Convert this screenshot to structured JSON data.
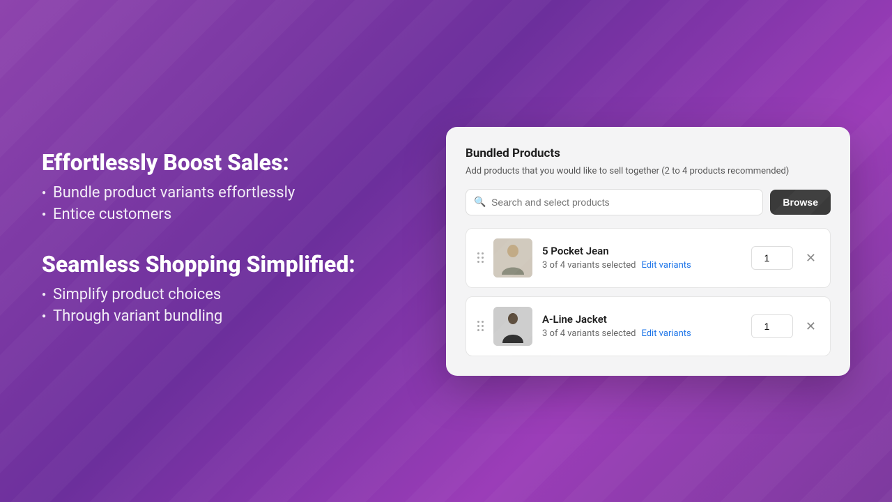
{
  "background": {
    "gradient_start": "#8e44ad",
    "gradient_end": "#6c2f9c"
  },
  "left": {
    "section1": {
      "heading": "Effortlessly Boost Sales:",
      "bullets": [
        "Bundle product variants effortlessly",
        "Entice customers"
      ]
    },
    "section2": {
      "heading": "Seamless Shopping Simplified:",
      "bullets": [
        "Simplify product choices",
        "Through variant bundling"
      ]
    }
  },
  "card": {
    "title": "Bundled Products",
    "description": "Add products that you would like to sell together (2 to 4 products recommended)",
    "search_placeholder": "Search and select products",
    "browse_label": "Browse",
    "products": [
      {
        "name": "5 Pocket Jean",
        "variants_text": "3 of 4 variants selected",
        "edit_label": "Edit variants",
        "quantity": 1,
        "image_type": "person-light"
      },
      {
        "name": "A-Line Jacket",
        "variants_text": "3 of 4 variants selected",
        "edit_label": "Edit variants",
        "quantity": 1,
        "image_type": "person-dark"
      }
    ]
  }
}
